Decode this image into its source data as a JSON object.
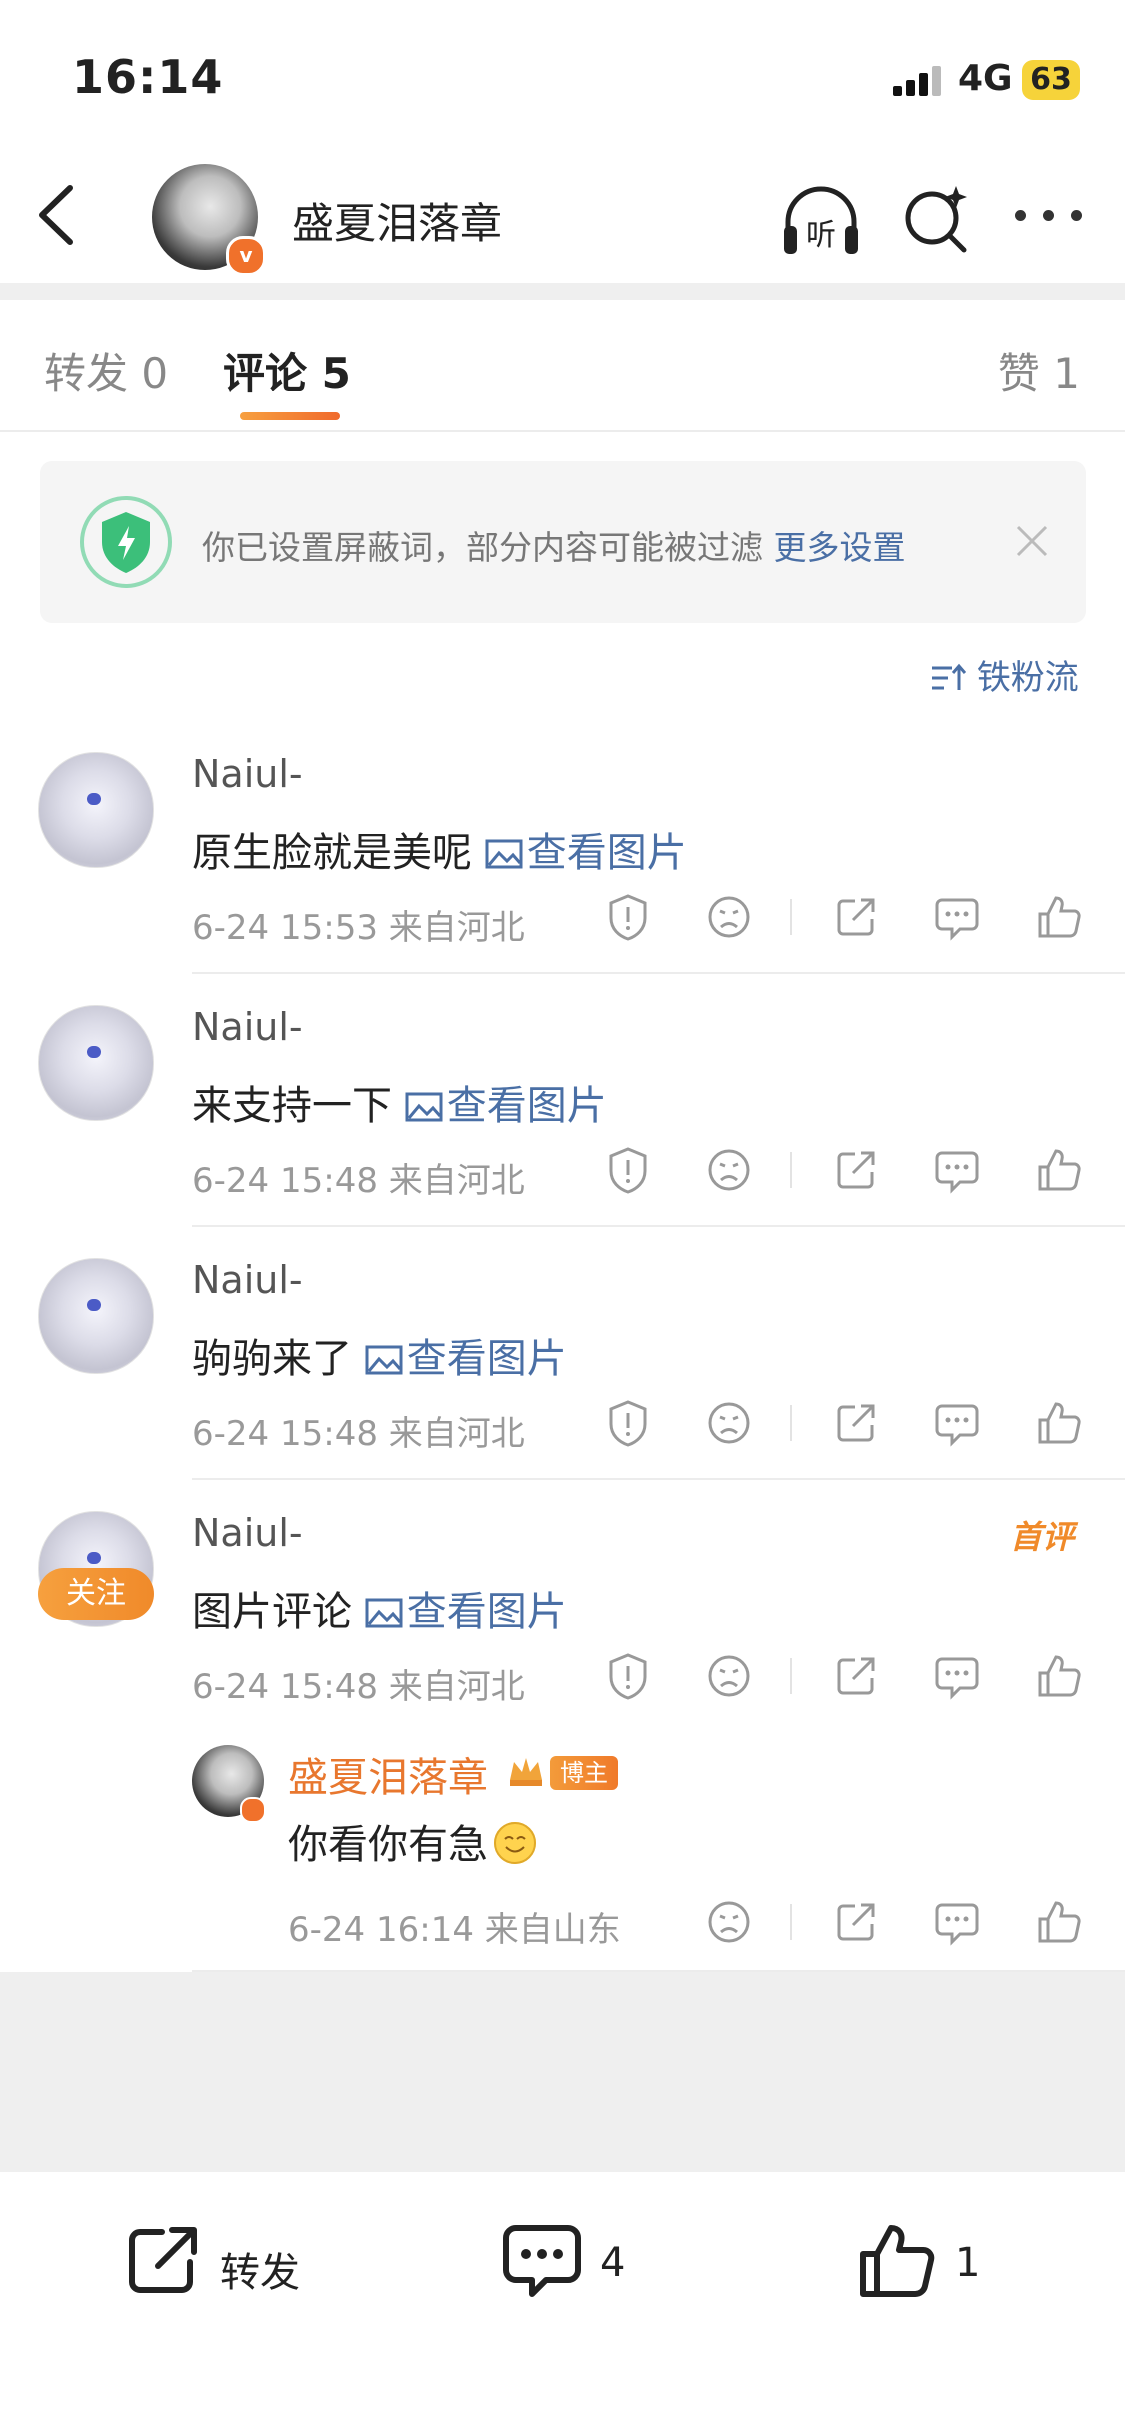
{
  "status_bar": {
    "time": "16:14",
    "network": "4G",
    "battery": "63"
  },
  "header": {
    "title": "盛夏泪落章",
    "listen_label": "听"
  },
  "tabs": [
    {
      "label": "转发 0"
    },
    {
      "label": "评论 5"
    },
    {
      "label": "赞 1"
    }
  ],
  "notice": {
    "text": "你已设置屏蔽词，部分内容可能被过滤",
    "link": "更多设置"
  },
  "sort_label": "铁粉流",
  "comments": [
    {
      "user": "Naiul-",
      "text": "原生脸就是美呢",
      "view_pic": "查看图片",
      "meta": "6-24 15:53  来自河北"
    },
    {
      "user": "Naiul-",
      "text": "来支持一下",
      "view_pic": "查看图片",
      "meta": "6-24 15:48  来自河北"
    },
    {
      "user": "Naiul-",
      "text": "驹驹来了",
      "view_pic": "查看图片",
      "meta": "6-24 15:48  来自河北"
    },
    {
      "user": "Naiul-",
      "text": "图片评论",
      "view_pic": "查看图片",
      "meta": "6-24 15:48  来自河北",
      "badge": "首评",
      "follow": "关注"
    }
  ],
  "reply": {
    "user": "盛夏泪落章",
    "badge": "博主",
    "text": "你看你有急",
    "meta": "6-24 16:14  来自山东"
  },
  "bottom_bar": {
    "repost": "转发",
    "comment_count": "4",
    "like_count": "1"
  },
  "colors": {
    "accent": "#f08a2a",
    "link": "#4a6fa5",
    "verified": "#f0712b",
    "battery": "#f6d33a"
  }
}
